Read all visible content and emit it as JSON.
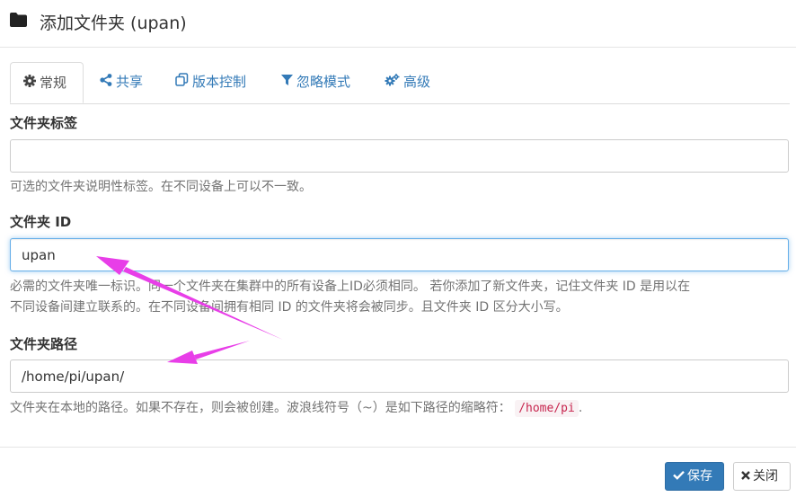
{
  "dialog": {
    "title": "添加文件夹 (upan)",
    "title_icon": "folder-icon"
  },
  "tabs": [
    {
      "label": "常规",
      "icon": "gear-icon",
      "active": true
    },
    {
      "label": "共享",
      "icon": "share-icon",
      "active": false
    },
    {
      "label": "版本控制",
      "icon": "copy-icon",
      "active": false
    },
    {
      "label": "忽略模式",
      "icon": "filter-icon",
      "active": false
    },
    {
      "label": "高级",
      "icon": "cogs-icon",
      "active": false
    }
  ],
  "fields": {
    "folder_label": {
      "label": "文件夹标签",
      "value": "",
      "help": "可选的文件夹说明性标签。在不同设备上可以不一致。"
    },
    "folder_id": {
      "label": "文件夹 ID",
      "value": "upan",
      "help_line1": "必需的文件夹唯一标识。同一个文件夹在集群中的所有设备上ID必须相同。 若你添加了新文件夹，记住文件夹 ID 是用以在",
      "help_line2": "不同设备间建立联系的。在不同设备间拥有相同 ID 的文件夹将会被同步。且文件夹 ID 区分大小写。"
    },
    "folder_path": {
      "label": "文件夹路径",
      "value": "/home/pi/upan/",
      "help": "文件夹在本地的路径。如果不存在，则会被创建。波浪线符号（~）是如下路径的缩略符：",
      "help_code": "/home/pi",
      "help_end": "."
    }
  },
  "footer": {
    "save_label": "保存",
    "save_icon": "check-icon",
    "close_label": "关闭",
    "close_icon": "close-icon"
  },
  "colors": {
    "link": "#337ab7",
    "primary": "#337ab7",
    "annotation_arrow": "#e83ee8",
    "focus_border": "#66afe9"
  }
}
